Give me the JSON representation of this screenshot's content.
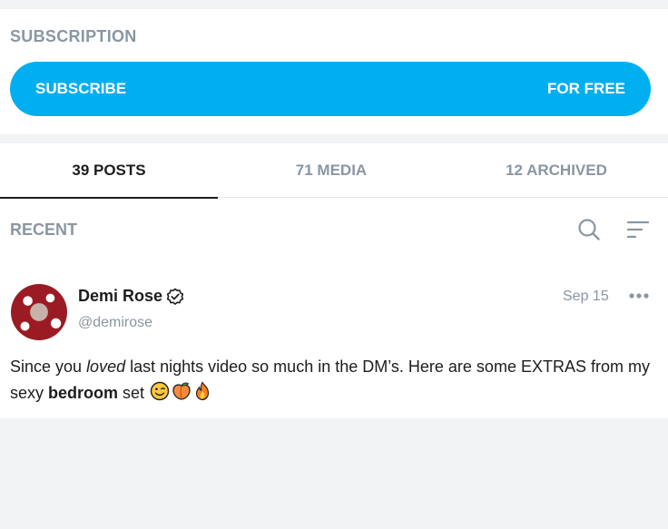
{
  "subscription": {
    "section_label": "SUBSCRIPTION",
    "subscribe_label": "SUBSCRIBE",
    "price_label": "FOR FREE"
  },
  "tabs": [
    {
      "label": "39 POSTS",
      "active": true
    },
    {
      "label": "71 MEDIA",
      "active": false
    },
    {
      "label": "12 ARCHIVED",
      "active": false
    }
  ],
  "feed": {
    "section_label": "RECENT",
    "search_icon": "search-icon",
    "sort_icon": "sort-icon"
  },
  "post": {
    "author_name": "Demi Rose",
    "verified_icon": "verified-badge-icon",
    "handle": "@demirose",
    "date": "Sep 15",
    "more_icon": "more-dots-icon",
    "text_part1": "Since you ",
    "text_italic": "loved",
    "text_part2": " last nights video so much in the DM’s. Here are some EXTRAS from my sexy ",
    "text_bold": "bedroom",
    "text_part3": " set ",
    "emojis": [
      "winking-face-emoji",
      "peach-emoji",
      "fire-emoji"
    ]
  },
  "colors": {
    "accent": "#00aff0",
    "muted_text": "#8a96a3",
    "background": "#f2f3f5"
  }
}
